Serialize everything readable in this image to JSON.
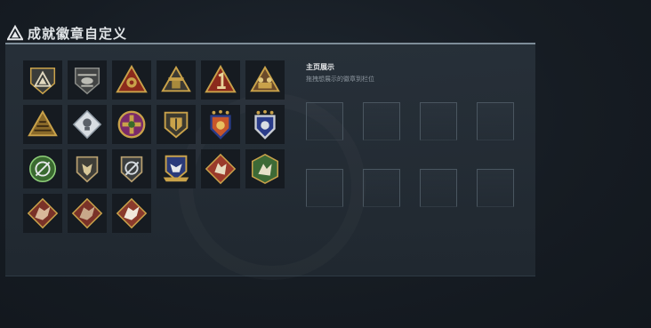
{
  "header": {
    "title": "成就徽章自定义",
    "logo_icon": "triangle-emblem-icon"
  },
  "collection": {
    "badges": [
      {
        "icon": "triangle-shield-badge-icon"
      },
      {
        "icon": "helicopter-shield-badge-icon"
      },
      {
        "icon": "red-triangle-emblem-badge-icon"
      },
      {
        "icon": "triangle-tower-badge-icon"
      },
      {
        "icon": "red-triangle-number-one-badge-icon"
      },
      {
        "icon": "triangle-soldiers-badge-icon"
      },
      {
        "icon": "triangle-stripes-badge-icon"
      },
      {
        "icon": "diamond-skull-badge-icon"
      },
      {
        "icon": "cross-wreath-badge-icon"
      },
      {
        "icon": "gold-shield-badge-icon"
      },
      {
        "icon": "starred-orange-shield-badge-icon"
      },
      {
        "icon": "starred-blue-shield-badge-icon"
      },
      {
        "icon": "green-scope-wreath-badge-icon"
      },
      {
        "icon": "fox-head-shield-badge-icon"
      },
      {
        "icon": "scope-slash-shield-badge-icon"
      },
      {
        "icon": "eagle-banner-shield-badge-icon"
      },
      {
        "icon": "wolf-diamond-badge-icon"
      },
      {
        "icon": "green-soldier-hex-badge-icon"
      },
      {
        "icon": "red-dragon-diamond-badge-icon"
      },
      {
        "icon": "red-dragon-diamond-badge-icon-2"
      },
      {
        "icon": "white-dragon-diamond-badge-icon"
      }
    ]
  },
  "display": {
    "title": "主页展示",
    "subtitle": "拖拽想展示的徽章到栏位",
    "slot_count": 8
  },
  "colors": {
    "panel_top_border": "#7e8d98",
    "gold": "#c9a24a",
    "red": "#8c2a1c",
    "slot_border": "#4a5660"
  }
}
